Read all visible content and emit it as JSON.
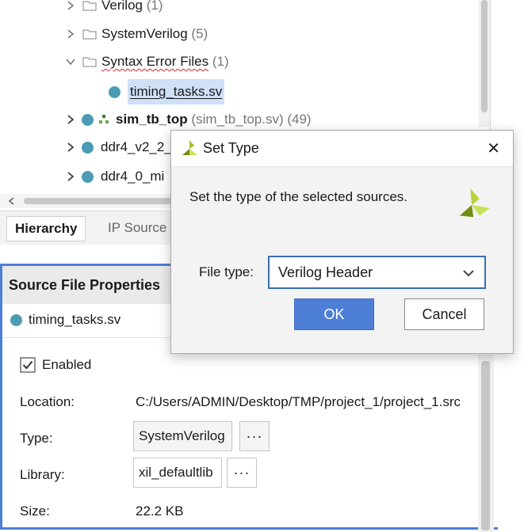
{
  "tree": {
    "items": [
      {
        "label": "Verilog",
        "count": "(1)"
      },
      {
        "label": "SystemVerilog",
        "count": "(5)"
      },
      {
        "label": "Syntax Error Files",
        "count": "(1)"
      },
      {
        "label": "timing_tasks.sv"
      },
      {
        "label": "sim_tb_top",
        "detail": "(sim_tb_top.sv)",
        "count": "(49)"
      },
      {
        "label": "ddr4_v2_2_"
      },
      {
        "label": "ddr4_0_mi"
      }
    ]
  },
  "tabs": [
    {
      "label": "Hierarchy"
    },
    {
      "label": "IP Source"
    }
  ],
  "properties": {
    "title": "Source File Properties",
    "file": "timing_tasks.sv",
    "enabled_label": "Enabled",
    "enabled": true,
    "location_label": "Location:",
    "location_value": "C:/Users/ADMIN/Desktop/TMP/project_1/project_1.src",
    "type_label": "Type:",
    "type_value": "SystemVerilog",
    "library_label": "Library:",
    "library_value": "xil_defaultlib",
    "size_label": "Size:",
    "size_value": "22.2 KB",
    "more_label": "···"
  },
  "dialog": {
    "title": "Set Type",
    "message": "Set the type of the selected sources.",
    "file_type_label": "File type:",
    "file_type_value": "Verilog Header",
    "ok_label": "OK",
    "cancel_label": "Cancel",
    "close_glyph": "✕"
  },
  "colors": {
    "accent": "#4e7fd6",
    "dot": "#4a9bb3",
    "logo": "#9fbf2a",
    "selection": "#cfe0f7"
  },
  "icons": {
    "chevron-right": "chevron-right-icon",
    "chevron-down": "chevron-down-icon",
    "folder": "folder-icon",
    "hierarchy": "hierarchy-icon",
    "checkbox": "checkbox-checked-icon",
    "logo": "vivado-logo-icon",
    "close": "close-icon",
    "dropdown": "dropdown-chevron-icon"
  }
}
